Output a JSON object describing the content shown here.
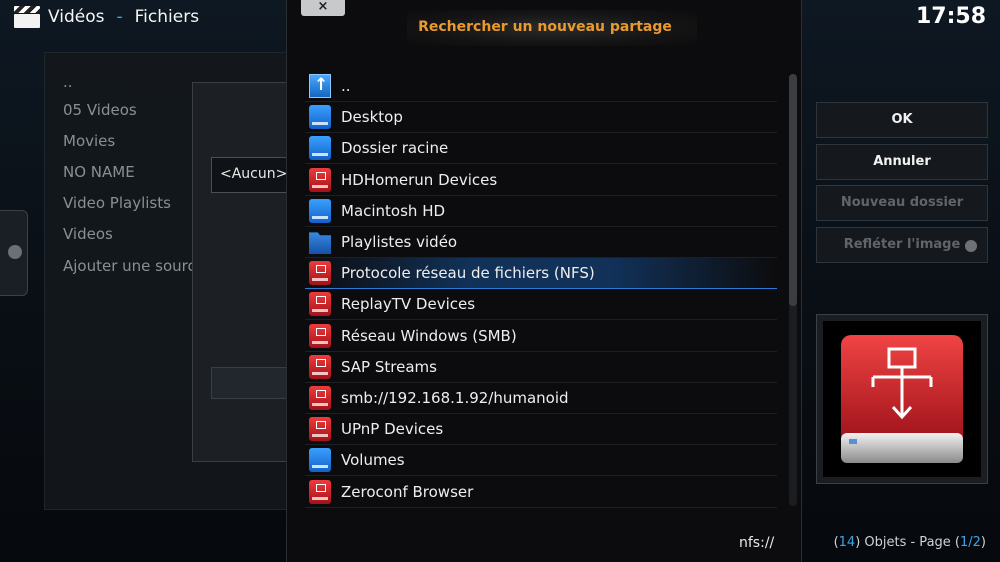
{
  "header": {
    "section": "Vidéos",
    "separator": "-",
    "subsection": "Fichiers",
    "clock": "17:58"
  },
  "library": {
    "items": [
      "..",
      "05 Videos",
      "Movies",
      "NO NAME",
      "Video Playlists",
      "Videos",
      "Ajouter une source"
    ]
  },
  "background_dialog": {
    "selected_value": "<Aucun>"
  },
  "dialog": {
    "close_label": "×",
    "title": "Rechercher un nouveau partage",
    "path": "nfs://",
    "focused_index": 6,
    "items": [
      {
        "label": "..",
        "icon": "folder-up-icon"
      },
      {
        "label": "Desktop",
        "icon": "drive-icon"
      },
      {
        "label": "Dossier racine",
        "icon": "drive-icon"
      },
      {
        "label": "HDHomerun Devices",
        "icon": "network-drive-icon"
      },
      {
        "label": "Macintosh HD",
        "icon": "drive-icon"
      },
      {
        "label": "Playlistes vidéo",
        "icon": "folder-icon"
      },
      {
        "label": "Protocole réseau de fichiers (NFS)",
        "icon": "network-drive-icon"
      },
      {
        "label": "ReplayTV Devices",
        "icon": "network-drive-icon"
      },
      {
        "label": "Réseau Windows (SMB)",
        "icon": "network-drive-icon"
      },
      {
        "label": "SAP Streams",
        "icon": "network-drive-icon"
      },
      {
        "label": "smb://192.168.1.92/humanoid",
        "icon": "network-drive-icon"
      },
      {
        "label": "UPnP Devices",
        "icon": "network-drive-icon"
      },
      {
        "label": "Volumes",
        "icon": "drive-icon"
      },
      {
        "label": "Zeroconf Browser",
        "icon": "network-drive-icon"
      }
    ]
  },
  "buttons": {
    "ok": "OK",
    "cancel": "Annuler",
    "new_folder": "Nouveau dossier",
    "mirror_image": "Refléter l'image"
  },
  "status": {
    "count": "14",
    "count_suffix": ") Objets - Page (",
    "page": "1/2",
    "close_paren": ")",
    "open_paren": "("
  },
  "colors": {
    "accent": "#3fa4e6",
    "title": "#e89a2e",
    "network_drive": "#c8202a",
    "local_drive": "#1f7be0"
  }
}
